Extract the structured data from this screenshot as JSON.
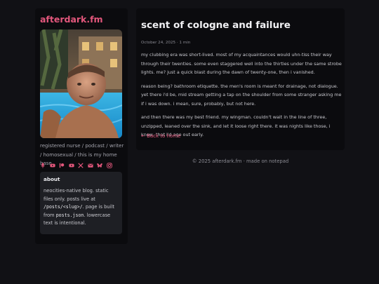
{
  "site": {
    "title": "afterdark.fm"
  },
  "bio": "registered nurse / podcast / writer / homosexual / this is my home base",
  "social_icons": [
    "microphone-icon",
    "youtube-icon",
    "patreon-icon",
    "youtube-alt-icon",
    "x-icon",
    "email-icon",
    "bluesky-icon",
    "instagram-icon"
  ],
  "about": {
    "heading": "about",
    "line1": "neocities-native blog. static files only. posts live at ",
    "path1": "/posts/<slug>/",
    "line2": ". page is built from ",
    "path2": "posts.json",
    "line3": ". lowercase text is intentional."
  },
  "post": {
    "title": "scent of cologne and failure",
    "meta": "October 24, 2025 · 1 min",
    "paragraphs": [
      "my clubbing era was short-lived. most of my acquaintances would uhn-tiss their way through their twenties. some even staggered well into the thirties under the same strobe lights. me? just a quick blast during the dawn of twenty-one, then i vanished.",
      "reason being? bathroom etiquette. the men's room is meant for drainage, not dialogue. yet there i'd be, mid stream getting a tap on the shoulder from some stranger asking me if i was down. i mean, sure, probably, but not here.",
      "and then there was my best friend. my wingman. couldn't wait in the line of three, unzipped, leaned over the sink, and let it loose right there. it was nights like those, i knew, that i'd age out early."
    ],
    "back_link": "← Back to home"
  },
  "footer": "© 2025 afterdark.fm · made on notepad",
  "colors": {
    "accent": "#e3577c",
    "background": "#111115",
    "panel": "#0b0b0e",
    "card": "#1e1f24"
  }
}
